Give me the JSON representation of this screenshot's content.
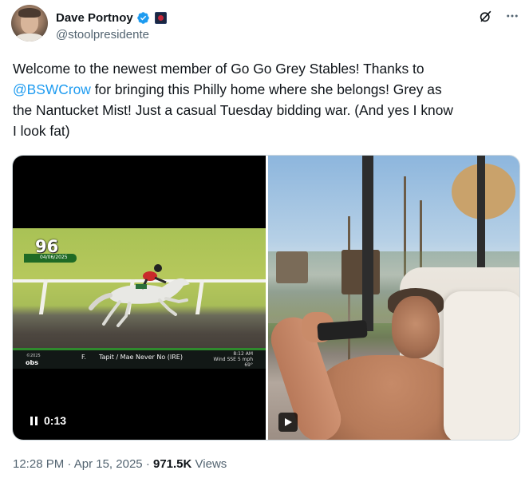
{
  "author": {
    "display_name": "Dave Portnoy",
    "handle": "@stoolpresidente",
    "verified_icon": "verified-badge-icon",
    "affiliate_icon": "affiliate-badge-icon"
  },
  "actions": {
    "grok_icon": "grok-icon",
    "more_icon": "more-options-icon"
  },
  "tweet": {
    "line1": "Welcome to the newest member of Go Go Grey Stables!   Thanks to",
    "line2_mention": "@BSWCrow",
    "line2_rest": " for bringing this Philly home where she belongs!   Grey as",
    "line3": "the Nantucket Mist!   Just a casual Tuesday bidding war.   (And yes I know",
    "line4": "I look fat)"
  },
  "video": {
    "score": "96",
    "race_date": "04/06/2025",
    "copyright": "©2025",
    "network": "obs",
    "sex": "F.",
    "pedigree": "Tapit / Mae Never No (IRE)",
    "clock_time": "8:12 AM",
    "wind": "Wind SSE 5 mph",
    "temp": "69°",
    "elapsed": "0:13"
  },
  "footer": {
    "time": "12:28 PM",
    "date": "Apr 15, 2025",
    "views_count": "971.5K",
    "views_label": "Views"
  },
  "colors": {
    "link": "#1d9bf0",
    "secondary_text": "#536471",
    "primary_text": "#0f1419"
  }
}
